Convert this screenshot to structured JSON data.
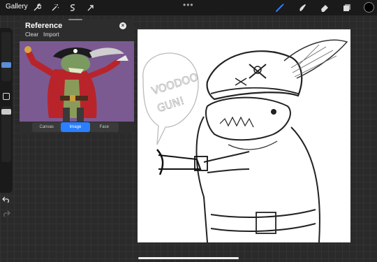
{
  "topbar": {
    "gallery_label": "Gallery",
    "more_label": "•••",
    "current_color": "#000000"
  },
  "sidebar": {
    "undo_icon": "undo-arrow",
    "redo_icon": "redo-arrow"
  },
  "reference_panel": {
    "title": "Reference",
    "clear_label": "Clear",
    "import_label": "Import",
    "tabs": [
      "Canvas",
      "Image",
      "Face"
    ],
    "active_tab": "Image"
  },
  "canvas": {
    "sketch_text": "VOODOO GUN!"
  },
  "colors": {
    "accent": "#2a7fff",
    "ui_dark": "#1a1a1a",
    "panel": "#2d2d2d"
  }
}
